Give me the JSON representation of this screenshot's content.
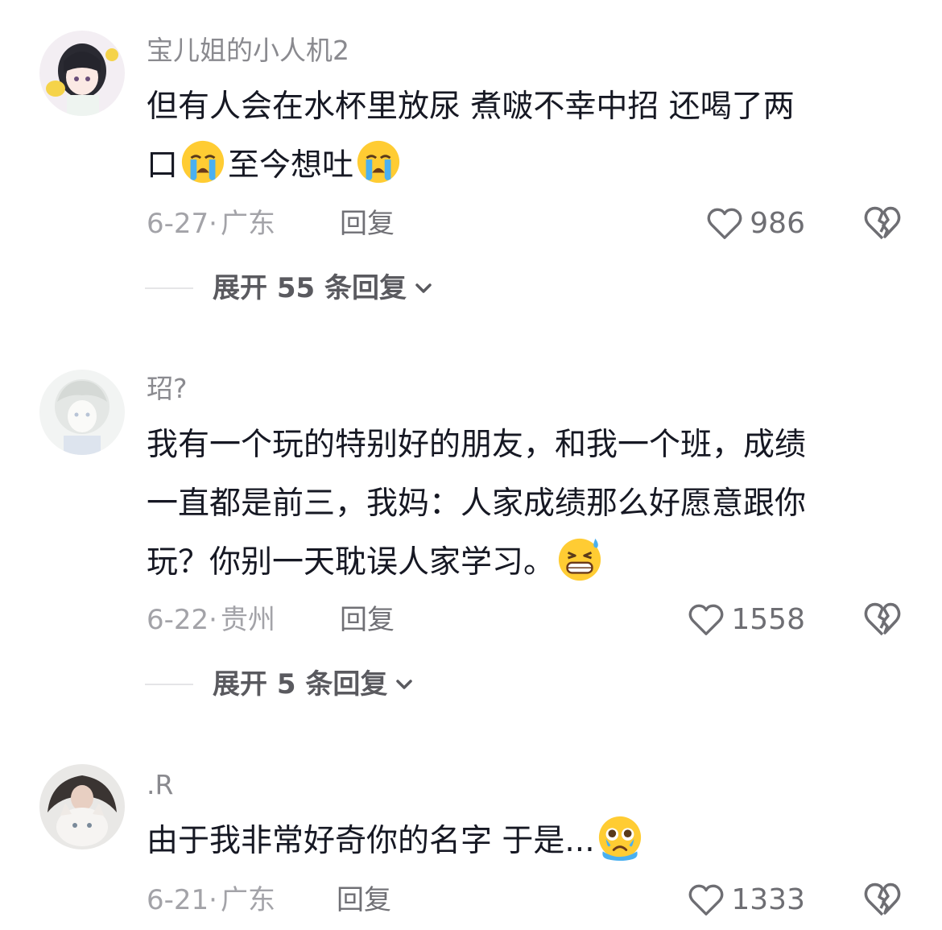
{
  "comments": [
    {
      "username": "宝儿姐的小人机2",
      "lines": [
        {
          "text_a": "但有人会在水杯里放尿 煮啵不幸中招 还喝了两"
        },
        {
          "text_a": "口",
          "text_b": "至今想吐"
        }
      ],
      "emoji": "loudly-crying-face",
      "date": "6-27",
      "separator": "·",
      "location": "广东",
      "reply_label": "回复",
      "likes": "986",
      "expand_label": "展开 55 条回复"
    },
    {
      "username": "玿?",
      "lines": [
        {
          "text_a": "我有一个玩的特别好的朋友，和我一个班，成绩"
        },
        {
          "text_a": "一直都是前三，我妈：人家成绩那么好愿意跟你"
        },
        {
          "text_a": "玩？你别一天耽误人家学习。"
        }
      ],
      "emoji": "grinning-sweat-face",
      "date": "6-22",
      "separator": "·",
      "location": "贵州",
      "reply_label": "回复",
      "likes": "1558",
      "expand_label": "展开 5 条回复"
    },
    {
      "username": ".R",
      "lines": [
        {
          "text_a": "由于我非常好奇你的名字  于是..."
        }
      ],
      "emoji": "pleading-tear-face",
      "date": "6-21",
      "separator": "·",
      "location": "广东",
      "reply_label": "回复",
      "likes": "1333"
    }
  ],
  "icons": {
    "like": "heart-outline-icon",
    "dislike": "broken-heart-icon",
    "expand": "chevron-down-icon"
  },
  "colors": {
    "text": "#161823",
    "secondary": "#8a8a8f",
    "emoji_face": "#ffcc33",
    "emoji_tear": "#4ab0f0"
  }
}
